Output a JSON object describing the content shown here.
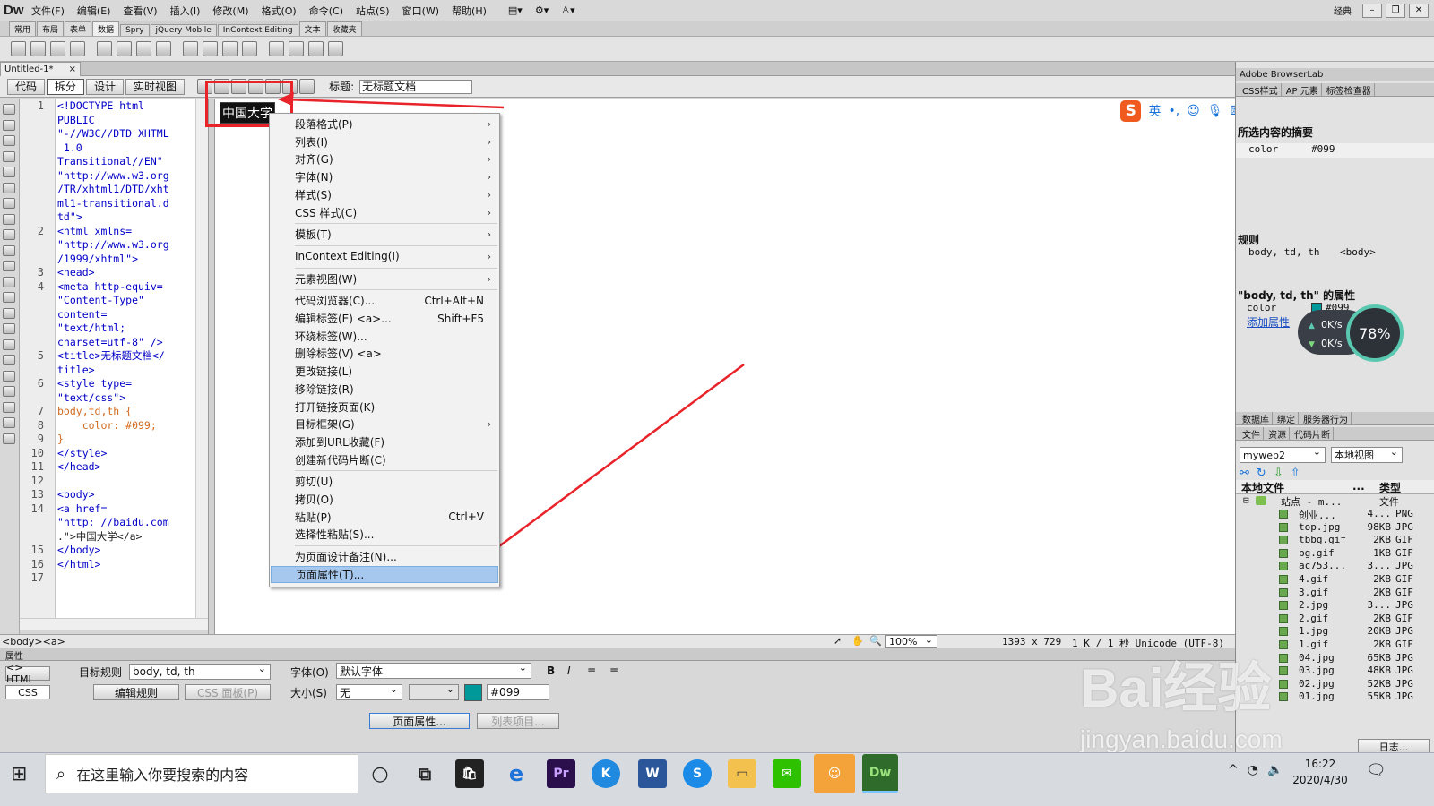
{
  "app": {
    "logo": "Dw",
    "menus": [
      "文件(F)",
      "编辑(E)",
      "查看(V)",
      "插入(I)",
      "修改(M)",
      "格式(O)",
      "命令(C)",
      "站点(S)",
      "窗口(W)",
      "帮助(H)"
    ],
    "workspace": "经典"
  },
  "insert_tabs": [
    "常用",
    "布局",
    "表单",
    "数据",
    "Spry",
    "jQuery Mobile",
    "InContext Editing",
    "文本",
    "收藏夹"
  ],
  "document": {
    "tab_name": "Untitled-1*",
    "close": "×",
    "views": [
      "代码",
      "拆分",
      "设计",
      "实时视图"
    ],
    "title_label": "标题:",
    "title_value": "无标题文档"
  },
  "code": {
    "lines": [
      {
        "n": "1",
        "text": "<!DOCTYPE html"
      },
      {
        "n": "",
        "text": "PUBLIC"
      },
      {
        "n": "",
        "text": "\"-//W3C//DTD XHTML"
      },
      {
        "n": "",
        "text": " 1.0"
      },
      {
        "n": "",
        "text": "Transitional//EN\""
      },
      {
        "n": "",
        "text": "\"http://www.w3.org"
      },
      {
        "n": "",
        "text": "/TR/xhtml1/DTD/xht"
      },
      {
        "n": "",
        "text": "ml1-transitional.d"
      },
      {
        "n": "",
        "text": "td\">"
      },
      {
        "n": "2",
        "text": "<html xmlns="
      },
      {
        "n": "",
        "text": "\"http://www.w3.org"
      },
      {
        "n": "",
        "text": "/1999/xhtml\">"
      },
      {
        "n": "3",
        "text": "<head>"
      },
      {
        "n": "4",
        "text": "<meta http-equiv="
      },
      {
        "n": "",
        "text": "\"Content-Type\""
      },
      {
        "n": "",
        "text": "content="
      },
      {
        "n": "",
        "text": "\"text/html;"
      },
      {
        "n": "",
        "text": "charset=utf-8\" />"
      },
      {
        "n": "5",
        "text": "<title>无标题文档</"
      },
      {
        "n": "",
        "text": "title>"
      },
      {
        "n": "6",
        "text": "<style type="
      },
      {
        "n": "",
        "text": "\"text/css\">"
      },
      {
        "n": "7",
        "text": "body,td,th {"
      },
      {
        "n": "8",
        "text": "    color: #099;"
      },
      {
        "n": "9",
        "text": "}"
      },
      {
        "n": "10",
        "text": "</style>"
      },
      {
        "n": "11",
        "text": "</head>"
      },
      {
        "n": "12",
        "text": ""
      },
      {
        "n": "13",
        "text": "<body>"
      },
      {
        "n": "14",
        "text": "<a href="
      },
      {
        "n": "",
        "text": "\"http: //baidu.com"
      },
      {
        "n": "",
        "text": ".\">中国大学</a>"
      },
      {
        "n": "15",
        "text": "</body>"
      },
      {
        "n": "16",
        "text": "</html>"
      },
      {
        "n": "17",
        "text": ""
      }
    ]
  },
  "design": {
    "selected_text": "中国大学"
  },
  "context_menu": {
    "items": [
      {
        "label": "段落格式(P)",
        "submenu": true
      },
      {
        "label": "列表(I)",
        "submenu": true
      },
      {
        "label": "对齐(G)",
        "submenu": true
      },
      {
        "label": "字体(N)",
        "submenu": true
      },
      {
        "label": "样式(S)",
        "submenu": true
      },
      {
        "label": "CSS 样式(C)",
        "submenu": true
      },
      {
        "label": "模板(T)",
        "submenu": true
      },
      {
        "label": "InContext Editing(I)",
        "submenu": true
      },
      {
        "label": "元素视图(W)",
        "submenu": true
      },
      {
        "label": "代码浏览器(C)...",
        "shortcut": "Ctrl+Alt+N"
      },
      {
        "label": "编辑标签(E) <a>...",
        "shortcut": "Shift+F5"
      },
      {
        "label": "环绕标签(W)..."
      },
      {
        "label": "删除标签(V) <a>"
      },
      {
        "label": "更改链接(L)"
      },
      {
        "label": "移除链接(R)"
      },
      {
        "label": "打开链接页面(K)"
      },
      {
        "label": "目标框架(G)",
        "submenu": true
      },
      {
        "label": "添加到URL收藏(F)"
      },
      {
        "label": "创建新代码片断(C)"
      },
      {
        "label": "剪切(U)"
      },
      {
        "label": "拷贝(O)"
      },
      {
        "label": "粘贴(P)",
        "shortcut": "Ctrl+V"
      },
      {
        "label": "选择性粘贴(S)..."
      },
      {
        "label": "为页面设计备注(N)..."
      },
      {
        "label": "页面属性(T)...",
        "highlighted": true
      }
    ],
    "submenu_arrow": "›"
  },
  "ime": {
    "lang": "英",
    "punct": "•,"
  },
  "statusbar": {
    "tags": "<body><a>",
    "zoom": "100%",
    "size": "1393 x 729",
    "info": "1 K / 1 秒 Unicode (UTF-8)"
  },
  "properties": {
    "header": "属性",
    "html": "<> HTML",
    "css": "CSS",
    "target_rule_label": "目标规则",
    "target_rule": "body, td, th",
    "edit_rule": "编辑规则",
    "css_panel": "CSS 面板(P)",
    "font_label": "字体(O)",
    "font_value": "默认字体",
    "size_label": "大小(S)",
    "size_value": "无",
    "color_value": "#099",
    "page_props": "页面属性...",
    "list_item": "列表项目...",
    "bold": "B",
    "italic": "I"
  },
  "right_panel": {
    "browserlab": "Adobe BrowserLab",
    "css_tabs": [
      "CSS样式",
      "AP 元素",
      "标签检查器"
    ],
    "summary_title": "所选内容的摘要",
    "summary_prop": "color",
    "summary_val": "#099",
    "rules_title": "规则",
    "rule_selector": "body, td, th",
    "rule_tag": "<body>",
    "props_title": "\"body, td, th\" 的属性",
    "prop_color": "color",
    "prop_color_val": "#099",
    "add_prop": "添加属性",
    "db_tabs": [
      "数据库",
      "绑定",
      "服务器行为"
    ],
    "file_tabs": [
      "文件",
      "资源",
      "代码片断"
    ],
    "site": "myweb2",
    "view": "本地视图",
    "col_local": "本地文件",
    "col_size": "...",
    "col_type": "类型",
    "site_root": "站点 - m...",
    "site_root_type": "文件",
    "files": [
      {
        "name": "创业...",
        "size": "4...",
        "type": "PNG"
      },
      {
        "name": "top.jpg",
        "size": "98KB",
        "type": "JPG"
      },
      {
        "name": "tbbg.gif",
        "size": "2KB",
        "type": "GIF"
      },
      {
        "name": "bg.gif",
        "size": "1KB",
        "type": "GIF"
      },
      {
        "name": "ac753...",
        "size": "3...",
        "type": "JPG"
      },
      {
        "name": "4.gif",
        "size": "2KB",
        "type": "GIF"
      },
      {
        "name": "3.gif",
        "size": "2KB",
        "type": "GIF"
      },
      {
        "name": "2.jpg",
        "size": "3...",
        "type": "JPG"
      },
      {
        "name": "2.gif",
        "size": "2KB",
        "type": "GIF"
      },
      {
        "name": "1.jpg",
        "size": "20KB",
        "type": "JPG"
      },
      {
        "name": "1.gif",
        "size": "2KB",
        "type": "GIF"
      },
      {
        "name": "04.jpg",
        "size": "65KB",
        "type": "JPG"
      },
      {
        "name": "03.jpg",
        "size": "48KB",
        "type": "JPG"
      },
      {
        "name": "02.jpg",
        "size": "52KB",
        "type": "JPG"
      },
      {
        "name": "01.jpg",
        "size": "55KB",
        "type": "JPG"
      }
    ],
    "log": "日志..."
  },
  "speed_widget": {
    "up": "0K/s",
    "down": "0K/s",
    "percent": "78%"
  },
  "taskbar": {
    "search_placeholder": "在这里输入你要搜索的内容",
    "time": "16:22",
    "date": "2020/4/30"
  },
  "watermark": {
    "brand": "Bai经验",
    "site": "jingyan.baidu.com"
  },
  "colors": {
    "annotation_red": "#e8232a",
    "highlight": "#a6c8ee",
    "swatch": "#009999",
    "code_orange": "#d2691e",
    "code_blue": "#0000c8"
  }
}
